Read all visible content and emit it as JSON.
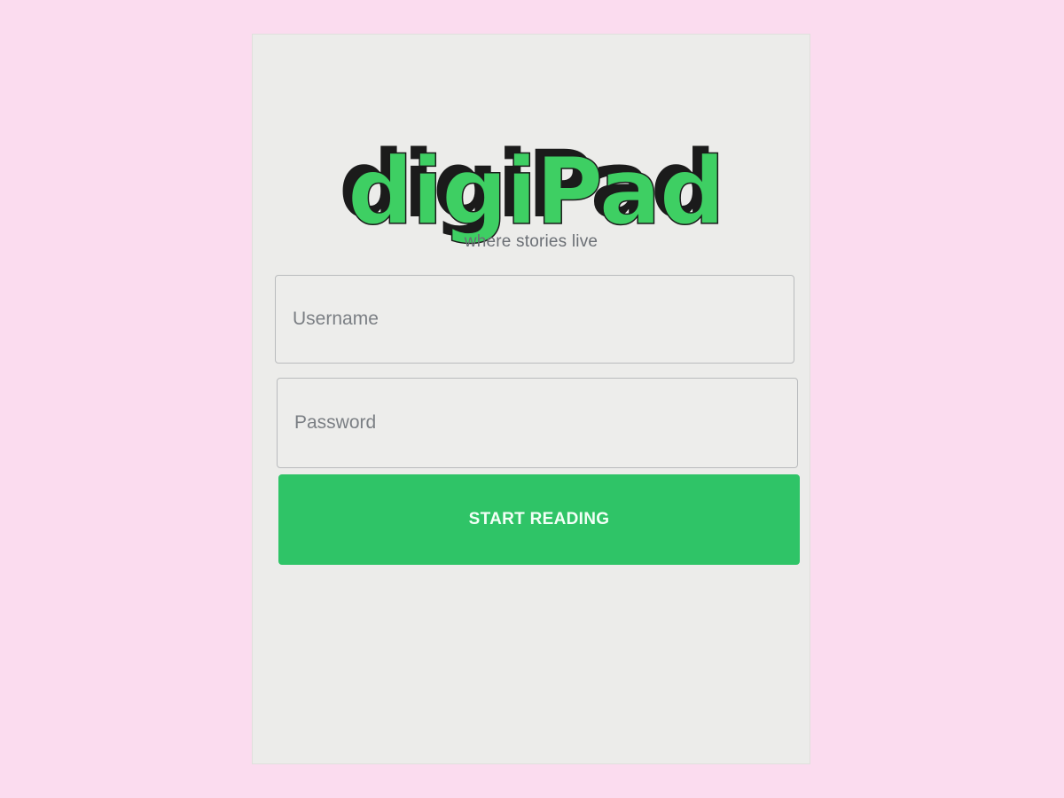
{
  "app": {
    "logo_text": "digiPad",
    "tagline": "where stories live"
  },
  "login_form": {
    "username_placeholder": "Username",
    "password_placeholder": "Password",
    "submit_label": "START READING"
  },
  "colors": {
    "background": "#fbdcef",
    "screen": "#ececea",
    "brand_green": "#2fc467",
    "logo_green": "#3ecf63",
    "logo_shadow": "#1b1b1b"
  }
}
